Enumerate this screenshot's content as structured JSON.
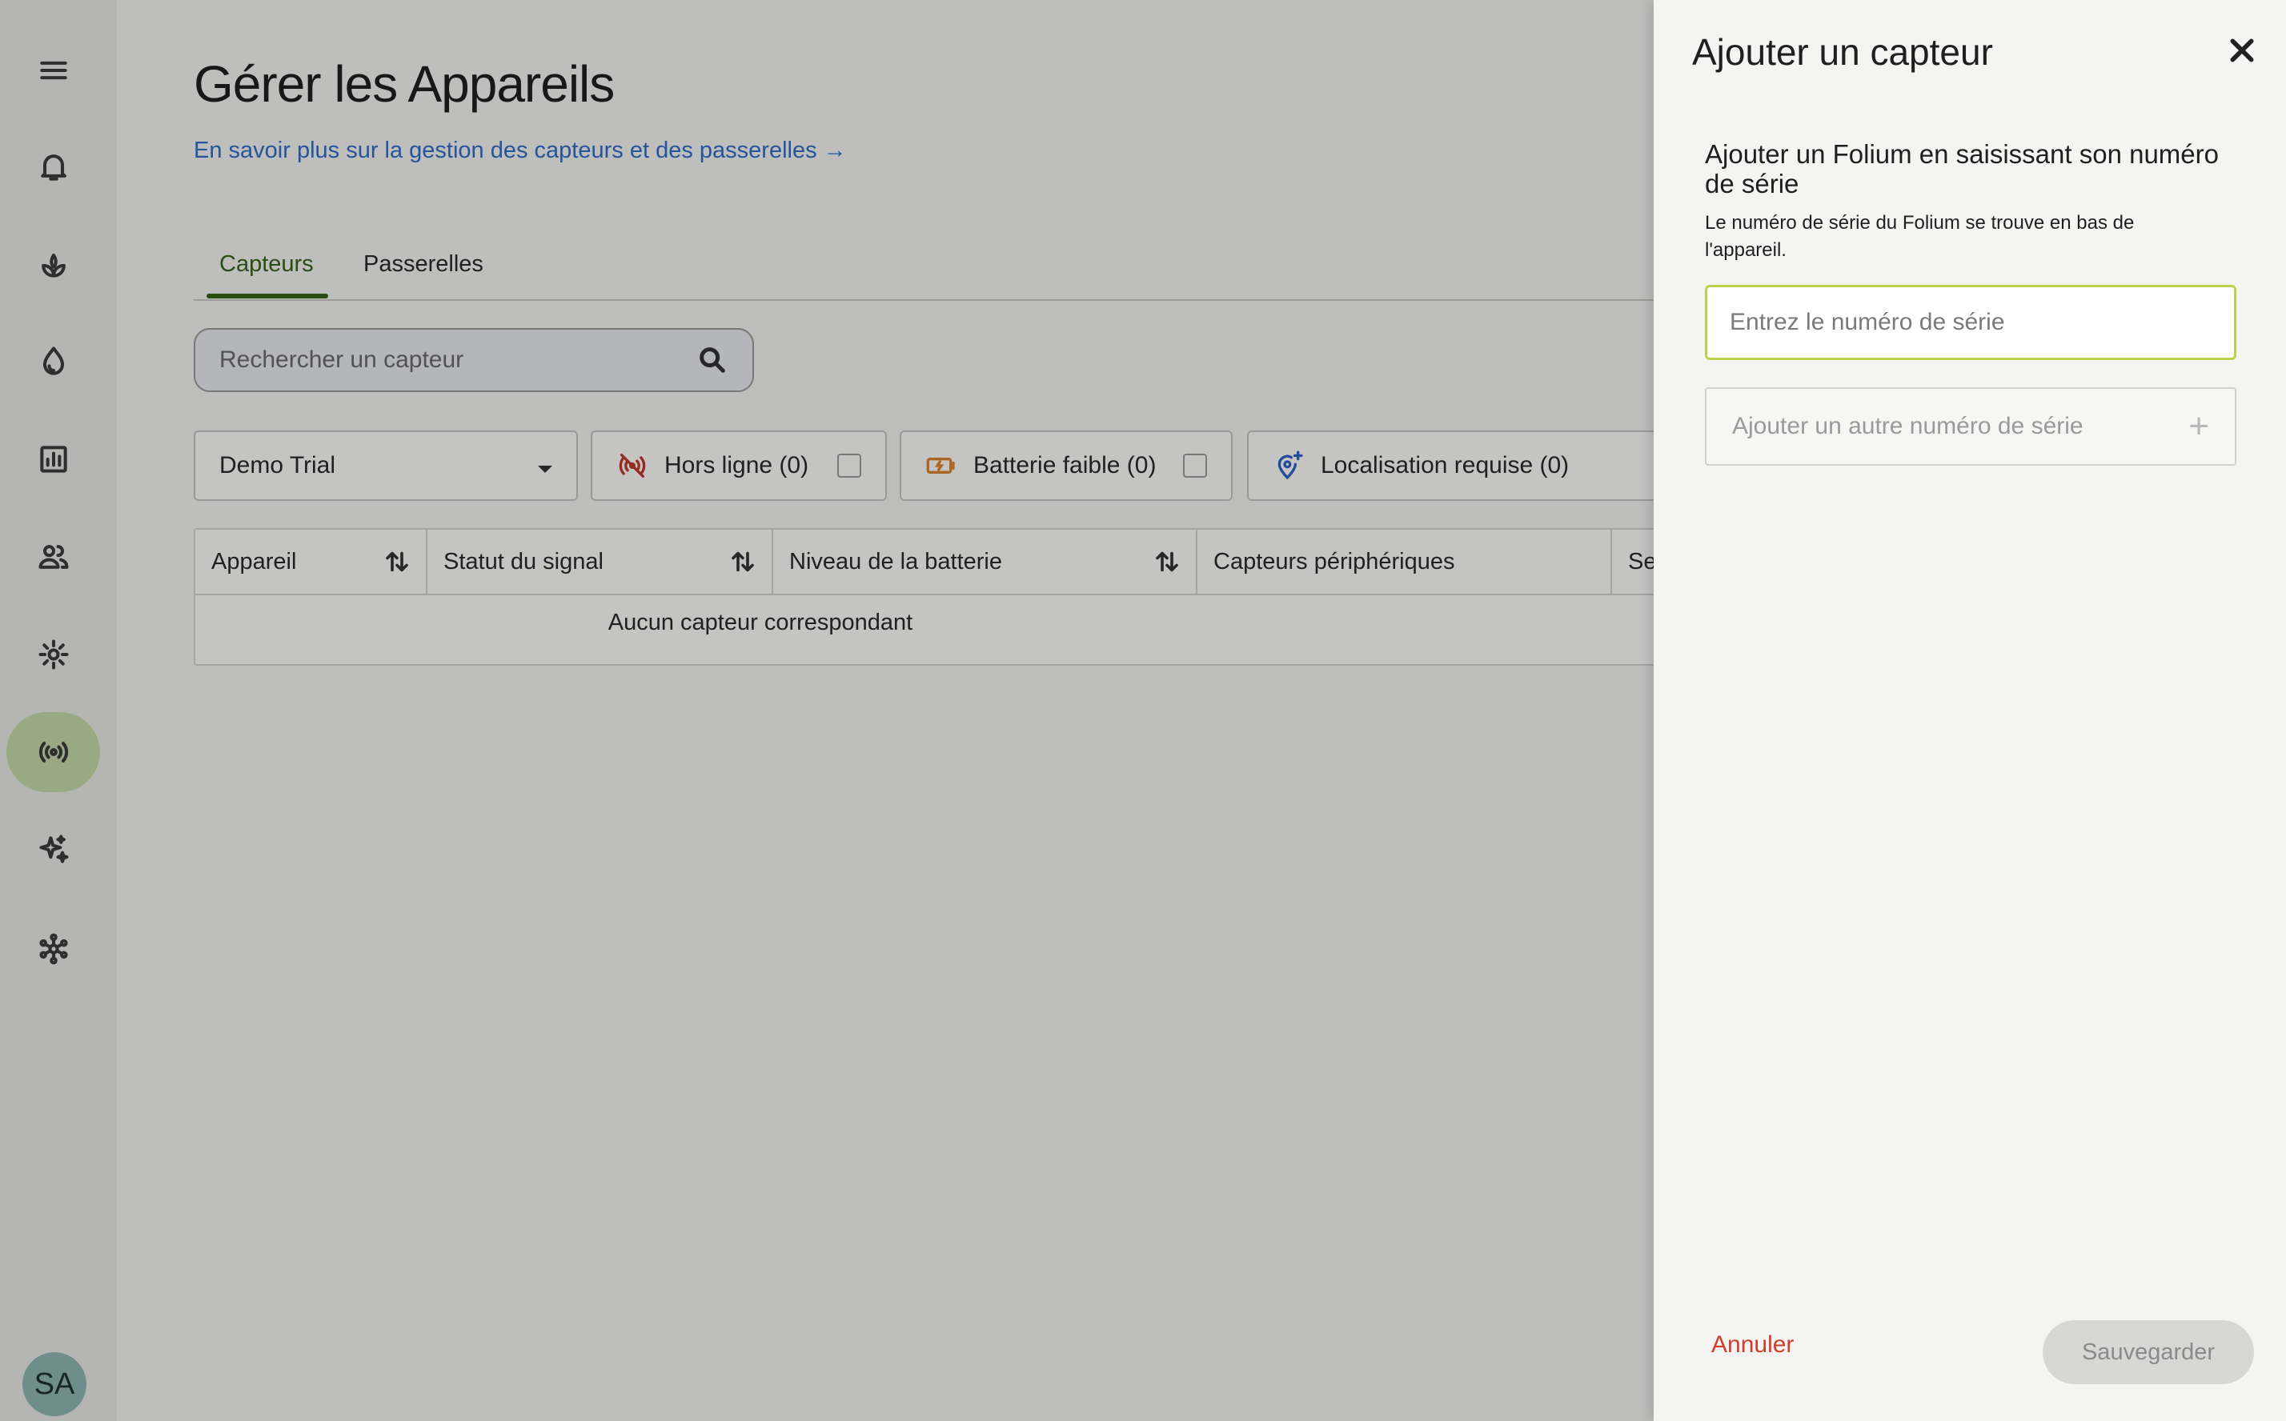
{
  "sidebar": {
    "items": [
      {
        "icon": "menu-icon"
      },
      {
        "icon": "bell-icon"
      },
      {
        "icon": "plant-icon"
      },
      {
        "icon": "water-drop-icon"
      },
      {
        "icon": "bar-chart-icon"
      },
      {
        "icon": "people-icon"
      },
      {
        "icon": "gear-icon"
      },
      {
        "icon": "sensor-broadcast-icon",
        "active": true
      },
      {
        "icon": "sparkles-icon"
      },
      {
        "icon": "network-hub-icon"
      }
    ],
    "avatar_initials": "SA"
  },
  "main": {
    "title": "Gérer les Appareils",
    "learn_link": "En savoir plus sur la gestion des capteurs et des passerelles →",
    "tabs": [
      {
        "label": "Capteurs",
        "active": true
      },
      {
        "label": "Passerelles",
        "active": false
      }
    ],
    "search_placeholder": "Rechercher un capteur",
    "org_select": "Demo Trial",
    "filters": {
      "offline": "Hors ligne (0)",
      "low_battery": "Batterie faible (0)",
      "location_required": "Localisation requise (0)"
    },
    "table": {
      "columns": [
        "Appareil",
        "Statut du signal",
        "Niveau de la batterie",
        "Capteurs périphériques",
        "Se"
      ],
      "empty_message": "Aucun capteur correspondant"
    }
  },
  "drawer": {
    "title": "Ajouter un capteur",
    "heading": "Ajouter un Folium en saisissant son numéro de série",
    "help": "Le numéro de série du Folium se trouve en bas de l'appareil.",
    "serial_placeholder": "Entrez le numéro de série",
    "add_another": "Ajouter un autre numéro de série",
    "cancel": "Annuler",
    "save": "Sauvegarder"
  },
  "colors": {
    "accent_green": "#37631a",
    "active_nav_bg": "#c5d9a8",
    "link_blue": "#2f6ec7",
    "cancel_red": "#d23c2c",
    "input_focus": "#b9d44c"
  }
}
